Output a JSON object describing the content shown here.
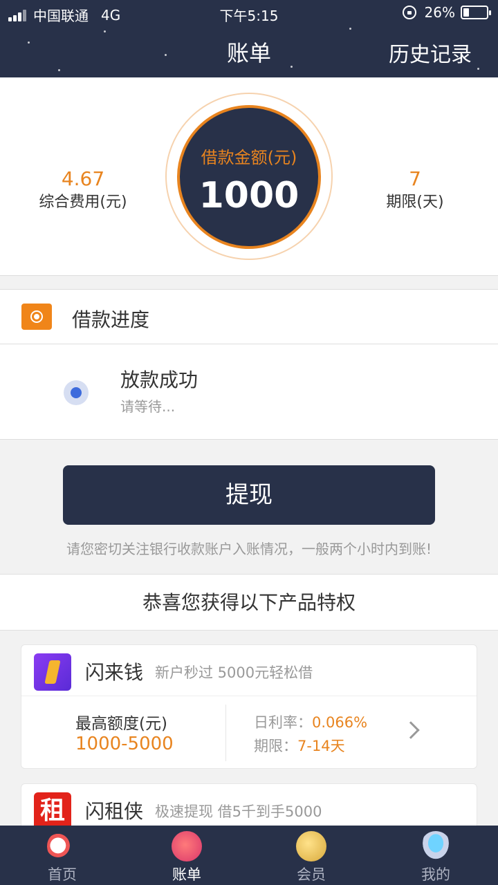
{
  "status_bar": {
    "carrier": "中国联通",
    "network": "4G",
    "time": "下午5:15",
    "battery_percent": "26%",
    "battery_level": 0.26
  },
  "header": {
    "title": "账单",
    "history_link": "历史记录"
  },
  "summary": {
    "fee_value": "4.67",
    "fee_label": "综合费用(元)",
    "amount_label": "借款金额(元)",
    "amount_value": "1000",
    "term_value": "7",
    "term_label": "期限(天)"
  },
  "progress": {
    "title": "借款进度",
    "step_title": "放款成功",
    "step_subtitle": "请等待..."
  },
  "withdraw": {
    "button_label": "提现",
    "notice": "请您密切关注银行收款账户入账情况，一般两个小时内到账!"
  },
  "privileges": {
    "heading": "恭喜您获得以下产品特权",
    "products": [
      {
        "name": "闪来钱",
        "desc": "新户秒过 5000元轻松借",
        "quota_label": "最高额度(元)",
        "quota_value": "1000-5000",
        "rate_label": "日利率：",
        "rate_value": "0.066%",
        "term_label": "期限：",
        "term_value": "7-14天"
      },
      {
        "name": "闪租侠",
        "desc": "极速提现 借5千到手5000",
        "logo_char": "租"
      }
    ]
  },
  "bottom_nav": [
    {
      "label": "首页",
      "icon": "rocket-icon"
    },
    {
      "label": "账单",
      "icon": "planet-icon",
      "active": true
    },
    {
      "label": "会员",
      "icon": "moon-icon"
    },
    {
      "label": "我的",
      "icon": "ufo-icon"
    }
  ],
  "colors": {
    "navy": "#283149",
    "orange": "#e8841f",
    "blue_dot": "#3d6bdc"
  }
}
